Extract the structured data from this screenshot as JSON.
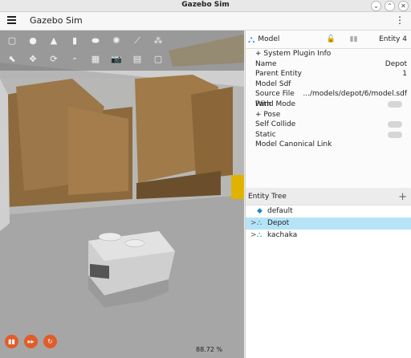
{
  "window": {
    "title": "Gazebo Sim",
    "buttons": [
      "⌄",
      "⌃",
      "✕"
    ]
  },
  "app": {
    "name": "Gazebo Sim",
    "menu_icon": "hamburger-icon",
    "more_icon": "kebab-icon"
  },
  "scene": {
    "toolbar_row1": [
      "▢",
      "●",
      "▲",
      "▮",
      "⬬",
      "✺",
      "⟋",
      "⁂"
    ],
    "toolbar_row2": [
      "⬉",
      "✥",
      "⟳",
      "⁃",
      "▦",
      "📷",
      "▤",
      "▢"
    ],
    "play_controls": [
      "▮▮",
      "▸▸",
      "↻"
    ],
    "zoom": "88.72 %"
  },
  "component_inspector": {
    "title": "Model",
    "entity_label": "Entity 4",
    "rows": [
      {
        "label": "+ System Plugin Info",
        "value": ""
      },
      {
        "label": "Name",
        "value": "Depot"
      },
      {
        "label": "Parent Entity",
        "value": "1"
      },
      {
        "label": "Model Sdf",
        "value": ""
      },
      {
        "label": "Source File Path",
        "value": ".../models/depot/6/model.sdf"
      },
      {
        "label": "Wind Mode",
        "value": ""
      },
      {
        "label": "+ Pose",
        "value": ""
      },
      {
        "label": "Self Collide",
        "value": ""
      },
      {
        "label": "Static",
        "value": ""
      },
      {
        "label": "Model Canonical Link",
        "value": ""
      }
    ]
  },
  "entity_tree": {
    "title": "Entity Tree",
    "items": [
      {
        "label": "default",
        "expander": ""
      },
      {
        "label": "Depot",
        "expander": ">"
      },
      {
        "label": "kachaka",
        "expander": ">"
      }
    ]
  }
}
